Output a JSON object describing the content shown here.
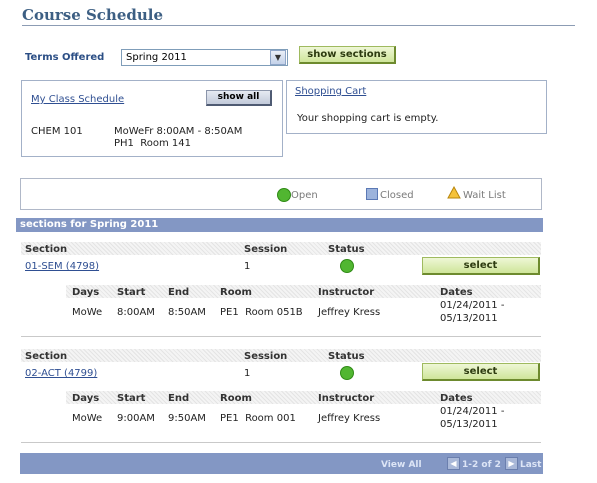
{
  "page": {
    "title": "Course Schedule"
  },
  "terms": {
    "label": "Terms Offered",
    "selected": "Spring 2011",
    "show_sections_label": "show sections"
  },
  "my_schedule": {
    "link": "My Class Schedule",
    "show_all_label": "show all",
    "entries": [
      {
        "course": "CHEM 101",
        "line1": "MoWeFr 8:00AM - 8:50AM",
        "line2": "PH1  Room 141"
      }
    ]
  },
  "cart": {
    "link": "Shopping Cart",
    "message": "Your shopping cart is empty."
  },
  "legend": {
    "open": "Open",
    "closed": "Closed",
    "wait_list": "Wait List"
  },
  "sections_band": "sections for Spring 2011",
  "columns": {
    "section": "Section",
    "session": "Session",
    "status": "Status"
  },
  "detail_columns": {
    "days": "Days",
    "start": "Start",
    "end": "End",
    "room": "Room",
    "instructor": "Instructor",
    "dates": "Dates"
  },
  "sections": [
    {
      "id": "01-SEM (4798)",
      "session": "1",
      "status": "Open",
      "select_label": "select",
      "days": "MoWe",
      "start": "8:00AM",
      "end": "8:50AM",
      "room": "PE1  Room 051B",
      "instructor": "Jeffrey Kress",
      "dates_line1": "01/24/2011 -",
      "dates_line2": "05/13/2011"
    },
    {
      "id": "02-ACT (4799)",
      "session": "1",
      "status": "Open",
      "select_label": "select",
      "days": "MoWe",
      "start": "9:00AM",
      "end": "9:50AM",
      "room": "PE1  Room 001",
      "instructor": "Jeffrey Kress",
      "dates_line1": "01/24/2011 -",
      "dates_line2": "05/13/2011"
    }
  ],
  "pager": {
    "view_all": "View All",
    "range": "1-2 of 2",
    "last": "Last"
  },
  "colors": {
    "band": "#8397c4",
    "open": "#51b631",
    "title": "#3d5f83"
  }
}
